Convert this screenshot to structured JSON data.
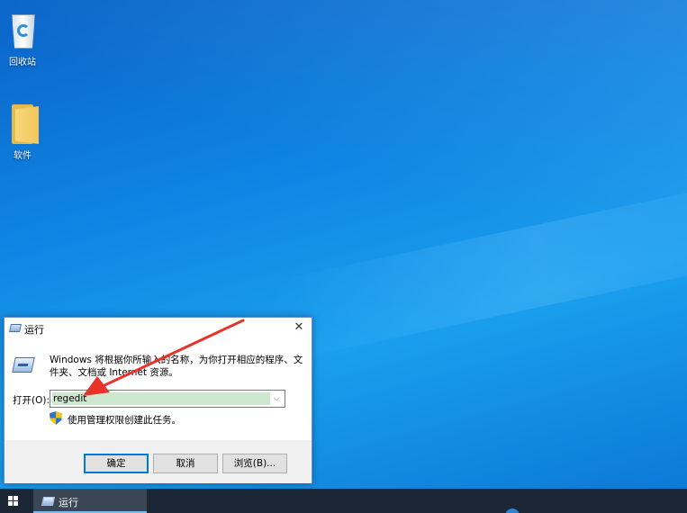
{
  "desktop": {
    "icons": [
      {
        "label": "回收站",
        "icon": "recycle-bin-icon"
      },
      {
        "label": "软件",
        "icon": "folder-icon"
      }
    ]
  },
  "run_dialog": {
    "title": "运行",
    "description": "Windows 将根据你所输入的名称，为你打开相应的程序、文件夹、文档或 Internet 资源。",
    "open_label": "打开(O):",
    "input_value": "regedit",
    "admin_note": "使用管理权限创建此任务。",
    "buttons": {
      "ok": "确定",
      "cancel": "取消",
      "browse": "浏览(B)..."
    },
    "close_glyph": "✕",
    "dropdown_glyph": "⌵"
  },
  "taskbar": {
    "active_task": "运行"
  },
  "colors": {
    "accent": "#0078d7",
    "annotation_arrow": "#e8332a",
    "input_highlight": "#cde8cf"
  }
}
